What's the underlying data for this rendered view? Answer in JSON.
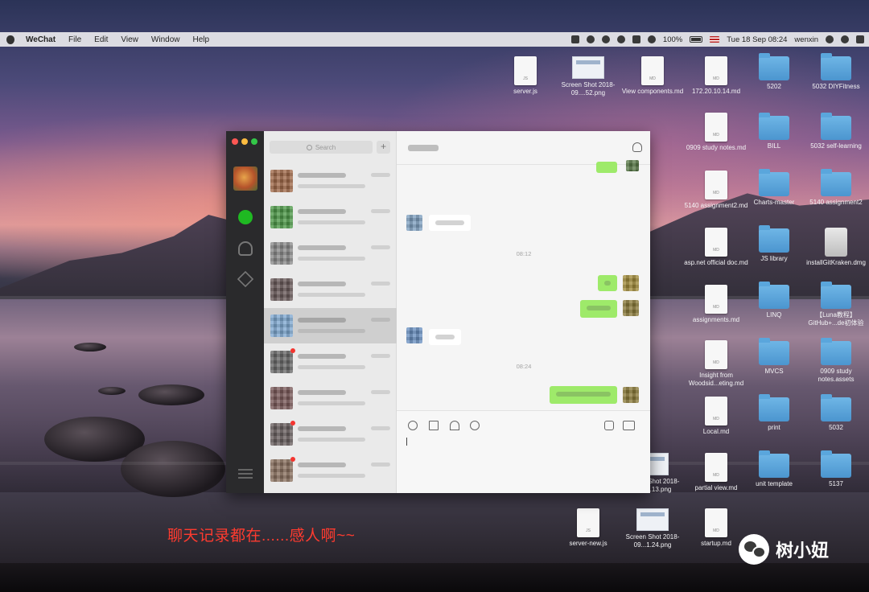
{
  "menubar": {
    "app_name": "WeChat",
    "menus": [
      "File",
      "Edit",
      "View",
      "Window",
      "Help"
    ],
    "battery": "100%",
    "clock": "Tue 18 Sep  08:24",
    "user": "wenxin"
  },
  "desktop_icons": [
    {
      "label": "server.js",
      "kind": "doc",
      "tag": "JS"
    },
    {
      "label": "Screen Shot 2018-09....52.png",
      "kind": "shot"
    },
    {
      "label": "View components.md",
      "kind": "doc",
      "tag": "MD"
    },
    {
      "label": "172.20.10.14.md",
      "kind": "doc",
      "tag": "MD"
    },
    {
      "label": "5202",
      "kind": "folder"
    },
    {
      "label": "5032 DIYFitness",
      "kind": "folder"
    },
    {
      "label": "0909 study notes.md",
      "kind": "doc",
      "tag": "MD"
    },
    {
      "label": "BILL",
      "kind": "folder"
    },
    {
      "label": "5032 self-learning",
      "kind": "folder"
    },
    {
      "label": "5140 assignment2.md",
      "kind": "doc",
      "tag": "MD"
    },
    {
      "label": "Charts-master",
      "kind": "folder"
    },
    {
      "label": "5140 assignment2",
      "kind": "folder"
    },
    {
      "label": "asp.net official doc.md",
      "kind": "doc",
      "tag": "MD"
    },
    {
      "label": "JS library",
      "kind": "folder"
    },
    {
      "label": "installGitKraken.dmg",
      "kind": "dmg"
    },
    {
      "label": "assignments.md",
      "kind": "doc",
      "tag": "MD"
    },
    {
      "label": "LINQ",
      "kind": "folder"
    },
    {
      "label": "【Luna教程】GitHub+...de初体验",
      "kind": "folder"
    },
    {
      "label": "Insight from Woodsid...eting.md",
      "kind": "doc",
      "tag": "MD"
    },
    {
      "label": "MVCS",
      "kind": "folder"
    },
    {
      "label": "0909 study notes.assets",
      "kind": "folder"
    },
    {
      "label": "Local.md",
      "kind": "doc",
      "tag": "MD"
    },
    {
      "label": "print",
      "kind": "folder"
    },
    {
      "label": "5032",
      "kind": "folder"
    },
    {
      "label": "partial view.md",
      "kind": "doc",
      "tag": "MD"
    },
    {
      "label": "unit template",
      "kind": "folder"
    },
    {
      "label": "5137",
      "kind": "folder"
    },
    {
      "label": "Screen Shot 2018-09...5.13.png",
      "kind": "shot"
    },
    {
      "label": "server-new.js",
      "kind": "doc",
      "tag": "JS"
    },
    {
      "label": "Screen Shot 2018-09...1.24.png",
      "kind": "shot"
    },
    {
      "label": "startup.md",
      "kind": "doc",
      "tag": "MD"
    }
  ],
  "wechat": {
    "search_placeholder": "Search",
    "add_label": "+",
    "chat_times": [
      "08:12",
      "08:24"
    ]
  },
  "overlay": {
    "caption": "聊天记录都在......感人啊~~",
    "watermark": "树小妞"
  }
}
